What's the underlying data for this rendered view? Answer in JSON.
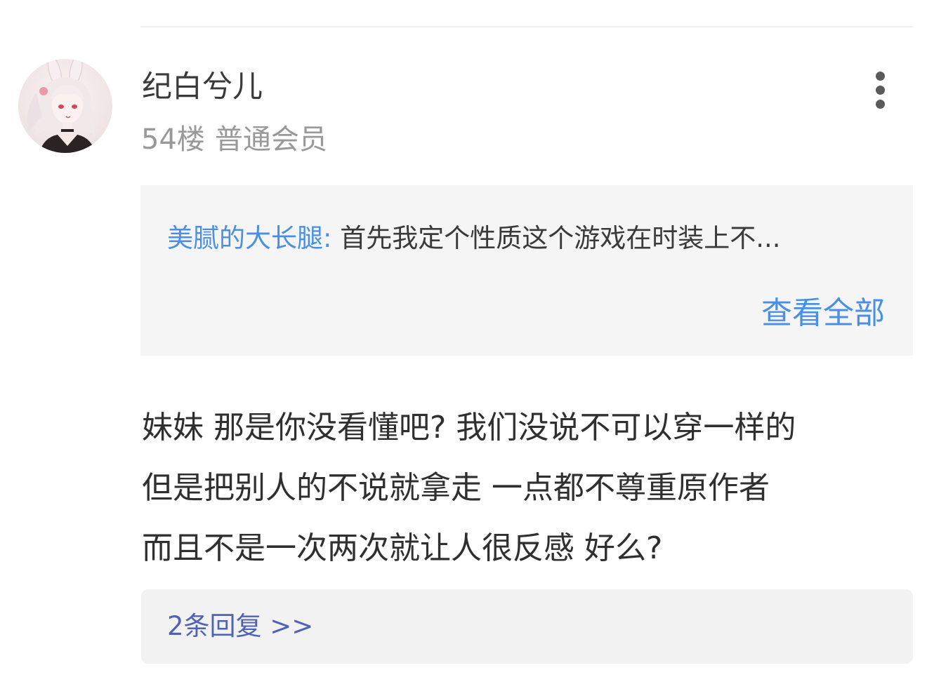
{
  "post": {
    "username": "纪白兮儿",
    "floor": "54楼",
    "member_level": "普通会员",
    "more_icon": "more-vertical-icon",
    "avatar": "user-avatar"
  },
  "quote": {
    "author": "美腻的大长腿:",
    "excerpt": "首先我定个性质这个游戏在时装上不...",
    "view_all": "查看全部"
  },
  "content": {
    "lines": [
      "妹妹 那是你没看懂吧? 我们没说不可以穿一样的",
      "但是把别人的不说就拿走 一点都不尊重原作者",
      "而且不是一次两次就让人很反感 好么?"
    ]
  },
  "replies": {
    "label": "2条回复 >>"
  },
  "colors": {
    "link_blue": "#4a90e2",
    "reply_blue": "#5062b4",
    "meta_gray": "#999999",
    "panel_bg": "#f5f5f5"
  }
}
